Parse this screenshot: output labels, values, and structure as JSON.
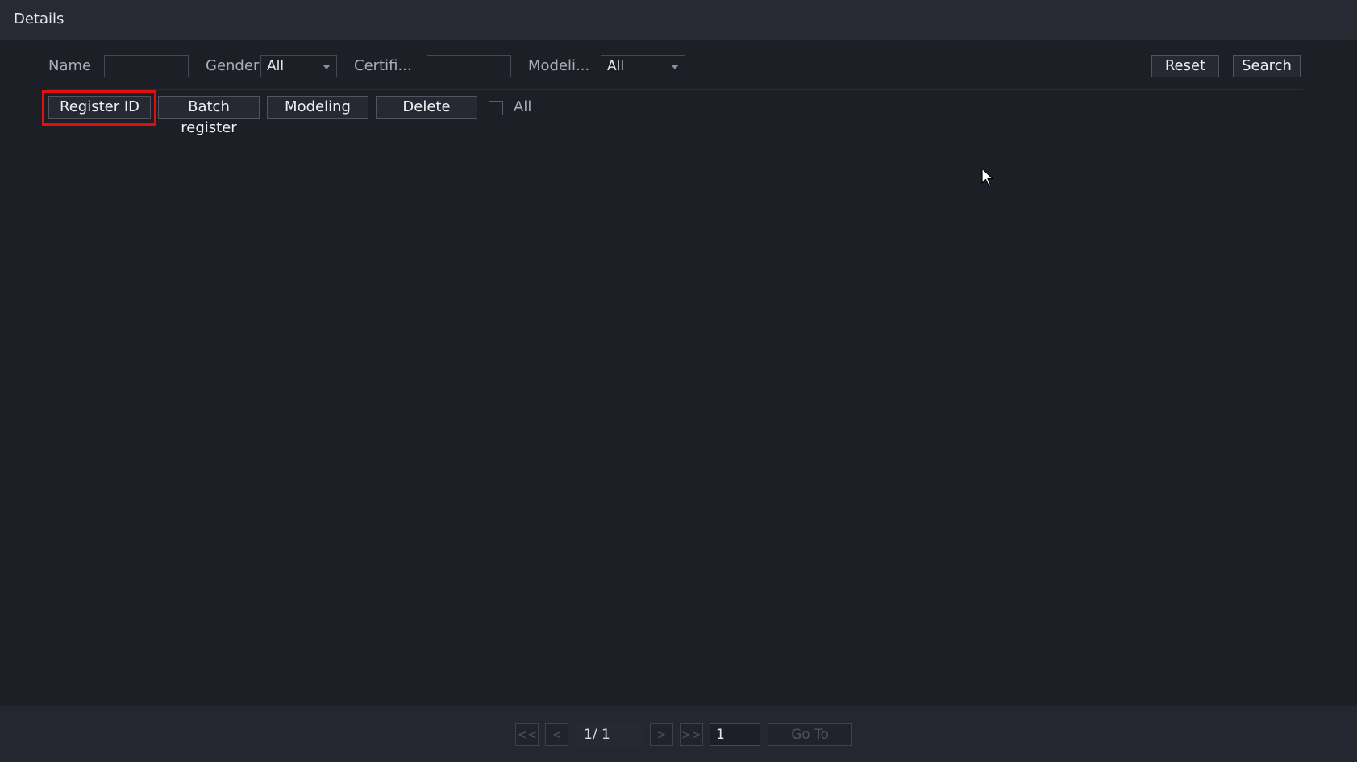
{
  "header": {
    "title": "Details"
  },
  "filters": {
    "name_label": "Name",
    "name_value": "",
    "gender_label": "Gender",
    "gender_value": "All",
    "certificate_label": "Certifi...",
    "certificate_value": "",
    "modeling_label": "Modeli...",
    "modeling_value": "All",
    "reset_label": "Reset",
    "search_label": "Search"
  },
  "toolbar": {
    "register_id_label": "Register ID",
    "batch_register_label": "Batch register",
    "modeling_label": "Modeling",
    "delete_label": "Delete",
    "select_all_label": "All",
    "select_all_checked": false
  },
  "pagination": {
    "first_label": "<<",
    "prev_label": "<",
    "page_indicator": "1/  1",
    "next_label": ">",
    "last_label": ">>",
    "page_input_value": "1",
    "goto_label": "Go To"
  },
  "colors": {
    "highlight": "#e01010",
    "background": "#1c1f26"
  }
}
